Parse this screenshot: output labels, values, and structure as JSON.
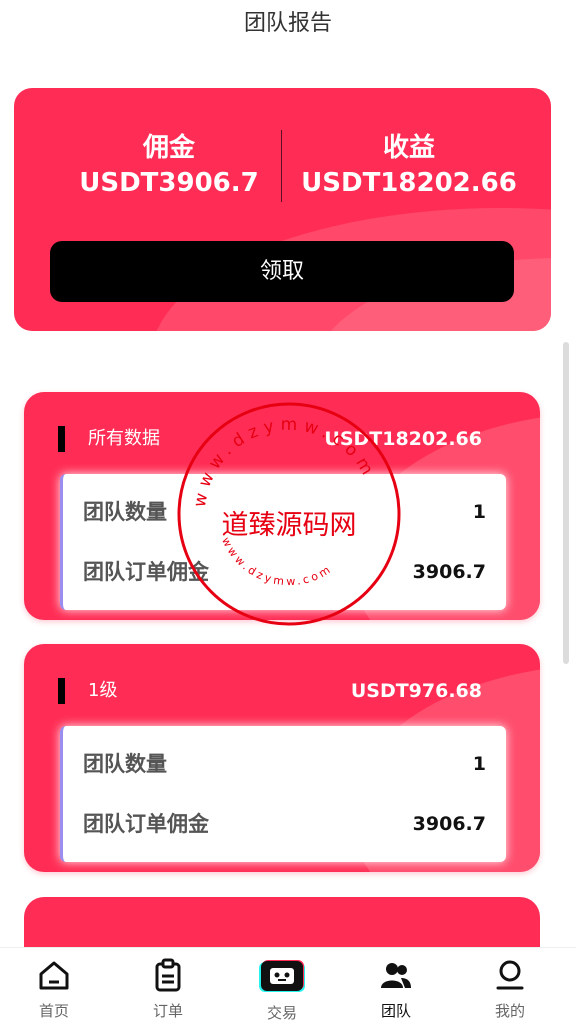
{
  "header": {
    "title": "团队报告"
  },
  "summary": {
    "commission_label": "佣金",
    "commission_value": "USDT3906.7",
    "earnings_label": "收益",
    "earnings_value": "USDT18202.66",
    "claim_label": "领取"
  },
  "cards": [
    {
      "title": "所有数据",
      "amount": "USDT18202.66",
      "team_count_label": "团队数量",
      "team_count_value": "1",
      "commission_label": "团队订单佣金",
      "commission_value": "3906.7"
    },
    {
      "title": "1级",
      "amount": "USDT976.68",
      "team_count_label": "团队数量",
      "team_count_value": "1",
      "commission_label": "团队订单佣金",
      "commission_value": "3906.7"
    }
  ],
  "watermark": {
    "main": "道臻源码网",
    "ring_top": "www.dzymw.com",
    "ring_bottom": "www.dzymw.com"
  },
  "tabbar": {
    "items": [
      {
        "label": "首页",
        "icon": "home-icon"
      },
      {
        "label": "订单",
        "icon": "clipboard-icon"
      },
      {
        "label": "交易",
        "icon": "robot-icon"
      },
      {
        "label": "团队",
        "icon": "team-icon",
        "active": true
      },
      {
        "label": "我的",
        "icon": "profile-icon"
      }
    ]
  },
  "colors": {
    "accent": "#ff2d55",
    "button": "#000000",
    "seal": "#e60012"
  }
}
